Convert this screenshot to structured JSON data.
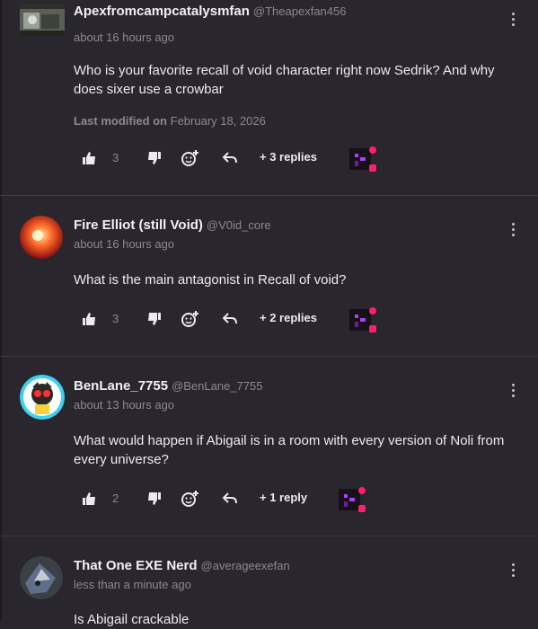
{
  "comments": [
    {
      "username": "Apexfromcampcatalysmfan",
      "handle": "@Theapexfan456",
      "time": "about 16 hours ago",
      "body": "Who is your favorite recall of void character right now Sedrik? And why does sixer use a crowbar",
      "modified_label": "Last modified on",
      "modified_date": "February 18, 2026",
      "likes": "3",
      "replies": "+ 3 replies"
    },
    {
      "username": "Fire Elliot (still Void)",
      "handle": "@V0id_core",
      "time": "about 16 hours ago",
      "body": "What is the main antagonist in Recall of void?",
      "likes": "3",
      "replies": "+ 2 replies"
    },
    {
      "username": "BenLane_7755",
      "handle": "@BenLane_7755",
      "time": "about 13 hours ago",
      "body": "What would happen if Abigail is in a room with every version of Noli from every universe?",
      "likes": "2",
      "replies": "+ 1 reply"
    },
    {
      "username": "That One EXE Nerd",
      "handle": "@averageexefan",
      "time": "less than a minute ago",
      "body": "Is Abigail crackable"
    }
  ],
  "icons": {
    "like": "thumbs-up-icon",
    "dislike": "thumbs-down-icon",
    "react": "add-reaction-icon",
    "reply": "reply-arrow-icon",
    "more": "more-vertical-icon"
  },
  "colors": {
    "background": "#29262d",
    "badge_pink": "#ff1f6e",
    "badge_purple": "#b03cff"
  }
}
